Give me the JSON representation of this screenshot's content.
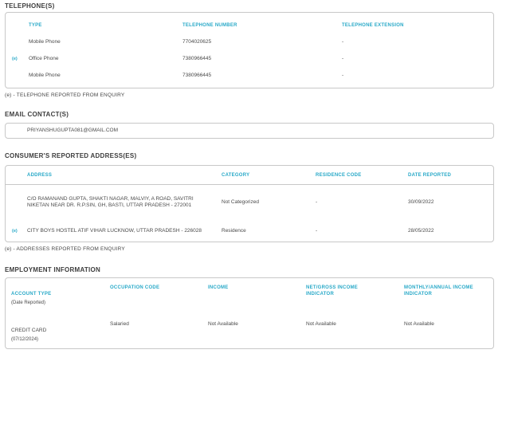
{
  "colors": {
    "accent": "#29a9c8",
    "heading_text": "#3d3d3d",
    "body_text": "#4a4a4a",
    "border": "#c8c8c8"
  },
  "telephones": {
    "title": "TELEPHONE(S)",
    "columns": [
      "TYPE",
      "TELEPHONE NUMBER",
      "TELEPHONE EXTENSION"
    ],
    "rows": [
      {
        "marker": "",
        "type": "Mobile Phone",
        "number": "7704020625",
        "extension": "-"
      },
      {
        "marker": "(e)",
        "type": "Office Phone",
        "number": "7380966445",
        "extension": "-"
      },
      {
        "marker": "",
        "type": "Mobile Phone",
        "number": "7380966445",
        "extension": "-"
      }
    ],
    "footnote": "(e) - TELEPHONE REPORTED FROM ENQUIRY"
  },
  "emails": {
    "title": "EMAIL CONTACT(S)",
    "items": [
      "PRIYANSHUGUPTA081@GMAIL.COM"
    ]
  },
  "addresses": {
    "title": "CONSUMER'S REPORTED ADDRESS(ES)",
    "columns": [
      "ADDRESS",
      "CATEGORY",
      "RESIDENCE CODE",
      "DATE REPORTED"
    ],
    "rows": [
      {
        "marker": "",
        "address": "C/O RAMANAND GUPTA, SHAKTI NAGAR, MALVIY, A ROAD, SAVITRI NIKETAN NEAR DR. R.P.SIN, GH, BASTI, UTTAR PRADESH - 272001",
        "category": "Not Categorized",
        "residence_code": "-",
        "date_reported": "30/09/2022"
      },
      {
        "marker": "(e)",
        "address": "CITY BOYS HOSTEL ATIF VIHAR LUCKNOW, UTTAR PRADESH - 226028",
        "category": "Residence",
        "residence_code": "-",
        "date_reported": "28/05/2022"
      }
    ],
    "footnote": "(e) - ADDRESSES REPORTED FROM ENQUIRY"
  },
  "employment": {
    "title": "EMPLOYMENT INFORMATION",
    "columns": [
      "ACCOUNT TYPE",
      "OCCUPATION CODE",
      "INCOME",
      "NET/GROSS INCOME\nINDICATOR",
      "MONTHLY/ANNUAL INCOME\nINDICATOR"
    ],
    "account_type_subtitle": "(Date Reported)",
    "rows": [
      {
        "account_type": "CREDIT CARD",
        "account_date": "(07/12/2024)",
        "occupation_code": "Salaried",
        "income": "Not Available",
        "net_gross_indicator": "Not Available",
        "monthly_annual_indicator": "Not Available"
      }
    ]
  }
}
